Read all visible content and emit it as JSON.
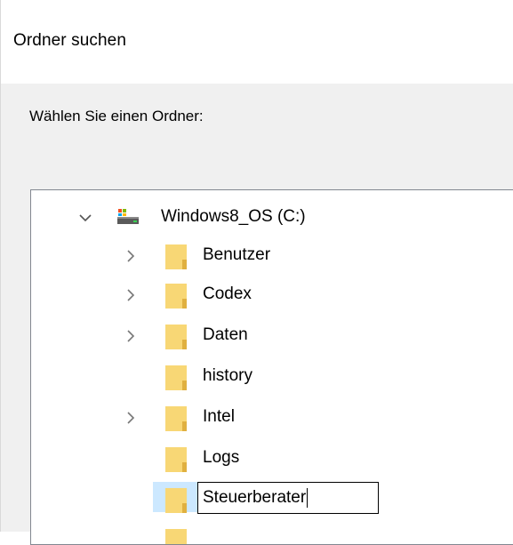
{
  "dialog": {
    "title": "Ordner suchen",
    "prompt": "Wählen Sie einen Ordner:"
  },
  "tree": {
    "root": {
      "label": "Windows8_OS (C:)",
      "icon": "drive-icon",
      "expanded": true
    },
    "items": [
      {
        "label": "Benutzer",
        "has_children": true
      },
      {
        "label": "Codex",
        "has_children": true
      },
      {
        "label": "Daten",
        "has_children": true
      },
      {
        "label": "history",
        "has_children": false
      },
      {
        "label": "Intel",
        "has_children": true
      },
      {
        "label": "Logs",
        "has_children": false
      },
      {
        "label": "Steuerberater",
        "has_children": false,
        "editing": true
      }
    ]
  },
  "colors": {
    "folder": "#f8d775",
    "folder_dark": "#e0b040",
    "selection": "#cce8ff",
    "chevron": "#555555"
  }
}
